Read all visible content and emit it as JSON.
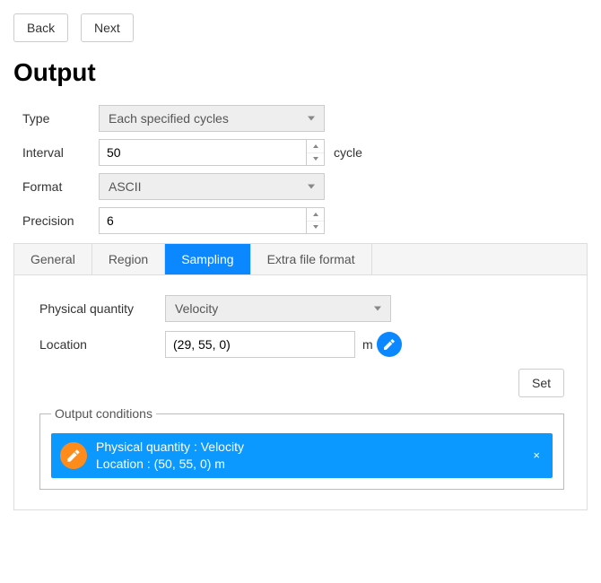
{
  "nav": {
    "back": "Back",
    "next": "Next"
  },
  "heading": "Output",
  "form": {
    "type_label": "Type",
    "type_value": "Each specified cycles",
    "interval_label": "Interval",
    "interval_value": "50",
    "interval_unit": "cycle",
    "format_label": "Format",
    "format_value": "ASCII",
    "precision_label": "Precision",
    "precision_value": "6"
  },
  "tabs": {
    "general": "General",
    "region": "Region",
    "sampling": "Sampling",
    "extra": "Extra file format"
  },
  "sampling": {
    "phys_label": "Physical quantity",
    "phys_value": "Velocity",
    "loc_label": "Location",
    "loc_value": "(29, 55, 0)",
    "loc_unit": "m",
    "set_btn": "Set",
    "conditions_legend": "Output conditions",
    "cond1_line1": "Physical quantity : Velocity",
    "cond1_line2": "Location : (50, 55, 0) m",
    "cond1_close": "×"
  }
}
